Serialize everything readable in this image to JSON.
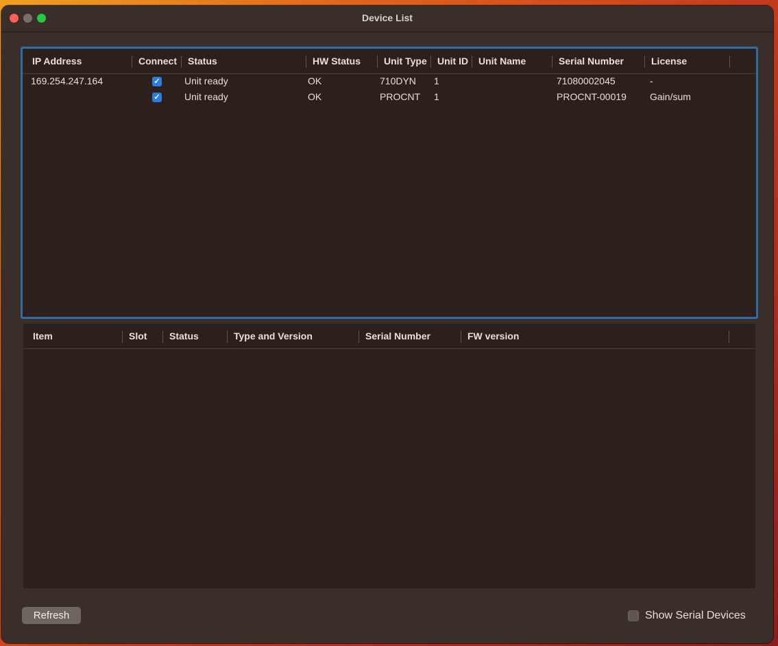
{
  "window": {
    "title": "Device List"
  },
  "device_table": {
    "columns": [
      "IP Address",
      "Connect",
      "Status",
      "HW Status",
      "Unit Type",
      "Unit ID",
      "Unit Name",
      "Serial Number",
      "License"
    ],
    "rows": [
      {
        "ip": "169.254.247.164",
        "connect": true,
        "status": "Unit ready",
        "hw_status": "OK",
        "unit_type": "710DYN",
        "unit_id": "1",
        "unit_name": "",
        "serial": "71080002045",
        "license": "-"
      },
      {
        "ip": "",
        "connect": true,
        "status": "Unit ready",
        "hw_status": "OK",
        "unit_type": "PROCNT",
        "unit_id": "1",
        "unit_name": "",
        "serial": "PROCNT-00019",
        "license": "Gain/sum"
      }
    ]
  },
  "module_table": {
    "columns": [
      "Item",
      "Slot",
      "Status",
      "Type and Version",
      "Serial Number",
      "FW version"
    ],
    "rows": []
  },
  "footer": {
    "refresh_label": "Refresh",
    "show_serial_label": "Show Serial Devices",
    "show_serial_checked": false
  },
  "colors": {
    "accent": "#2a7de1",
    "focus_ring": "#2e6ea8",
    "close": "#ff5f57",
    "zoom": "#28c840"
  }
}
